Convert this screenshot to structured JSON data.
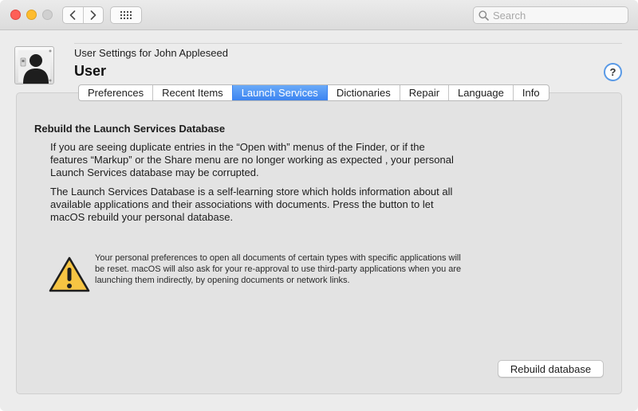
{
  "window": {
    "controls": [
      "close",
      "minimize",
      "zoom"
    ],
    "search": {
      "placeholder": "Search",
      "value": ""
    }
  },
  "header": {
    "subtitle": "User Settings for John Appleseed",
    "title": "User",
    "help_label": "?"
  },
  "tabs": [
    {
      "label": "Preferences",
      "active": false
    },
    {
      "label": "Recent Items",
      "active": false
    },
    {
      "label": "Launch Services",
      "active": true
    },
    {
      "label": "Dictionaries",
      "active": false
    },
    {
      "label": "Repair",
      "active": false
    },
    {
      "label": "Language",
      "active": false
    },
    {
      "label": "Info",
      "active": false
    }
  ],
  "content": {
    "section_title": "Rebuild the Launch Services Database",
    "paragraph1": "If you are seeing duplicate entries in the “Open with” menus of the Finder, or if the features “Markup” or the Share menu are no longer working as expected , your personal Launch Services database may be corrupted.",
    "paragraph2": "The Launch Services Database is a self-learning store which holds information about all available applications and their associations with documents. Press the button to let macOS rebuild your personal database.",
    "warning": "Your personal preferences to open all documents of certain types with specific applications will be reset. macOS will also ask for your re-approval to use third-party applications when you are launching them indirectly, by opening documents or network links.",
    "button_label": "Rebuild database"
  },
  "colors": {
    "accent": "#3c84f1",
    "close": "#fe5f57",
    "minimize": "#febc2e",
    "warning_fill": "#f6c443"
  },
  "icons": {
    "back": "chevron-left-icon",
    "forward": "chevron-right-icon",
    "grid": "grid-icon",
    "search": "magnifier-icon",
    "avatar": "user-silhouette-icon",
    "warning": "warning-triangle-icon"
  }
}
